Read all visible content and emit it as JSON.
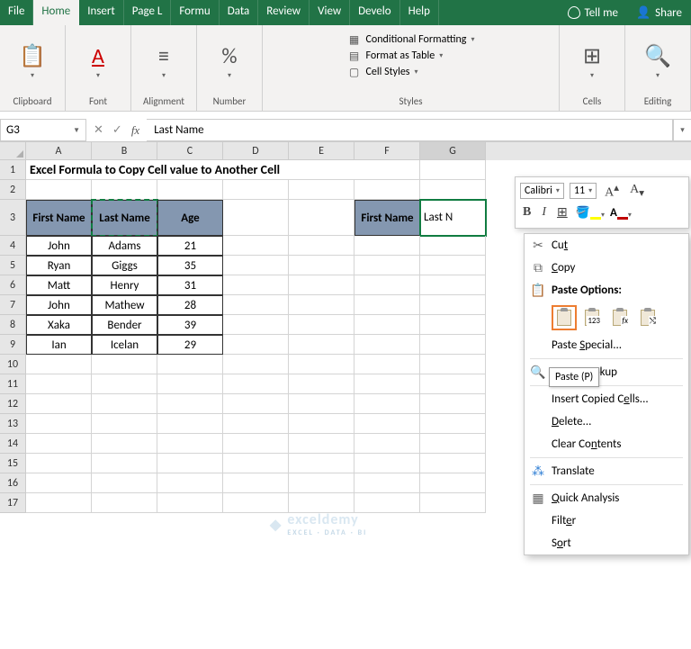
{
  "tabs": {
    "file": "File",
    "home": "Home",
    "insert": "Insert",
    "pagel": "Page L",
    "formu": "Formu",
    "data": "Data",
    "review": "Review",
    "view": "View",
    "devel": "Develo",
    "help": "Help",
    "tellme": "Tell me",
    "share": "Share"
  },
  "ribbon": {
    "clipboard": "Clipboard",
    "font": "Font",
    "alignment": "Alignment",
    "number": "Number",
    "styles": "Styles",
    "cells": "Cells",
    "editing": "Editing",
    "cond_fmt": "Conditional Formatting",
    "fmt_table": "Format as Table",
    "cell_styles": "Cell Styles"
  },
  "namebox": "G3",
  "formula": "Last Name",
  "cols": [
    "A",
    "B",
    "C",
    "D",
    "E",
    "F",
    "G"
  ],
  "title": "Excel Formula to Copy Cell value to Another Cell",
  "headers": {
    "first": "First Name",
    "last": "Last Name",
    "age": "Age"
  },
  "data": [
    {
      "first": "John",
      "last": "Adams",
      "age": "21"
    },
    {
      "first": "Ryan",
      "last": "Giggs",
      "age": "35"
    },
    {
      "first": "Matt",
      "last": "Henry",
      "age": "31"
    },
    {
      "first": "John",
      "last": "Mathew",
      "age": "28"
    },
    {
      "first": "Xaka",
      "last": "Bender",
      "age": "39"
    },
    {
      "first": "Ian",
      "last": "Icelan",
      "age": "29"
    }
  ],
  "dest_header": "First Name",
  "dest_partial": "Last N",
  "mini": {
    "font": "Calibri",
    "size": "11"
  },
  "ctx": {
    "cut": "Cut",
    "copy": "Copy",
    "paste_options": "Paste Options:",
    "paste_special": "Paste Special...",
    "smart_lookup": "Smart Lookup",
    "insert_copied": "Insert Copied Cells...",
    "delete": "Delete...",
    "clear": "Clear Contents",
    "translate": "Translate",
    "quick_analysis": "Quick Analysis",
    "filter": "Filter",
    "sort": "Sort",
    "tooltip": "Paste (P)"
  },
  "watermark": {
    "brand": "exceldemy",
    "sub": "EXCEL · DATA · BI"
  }
}
